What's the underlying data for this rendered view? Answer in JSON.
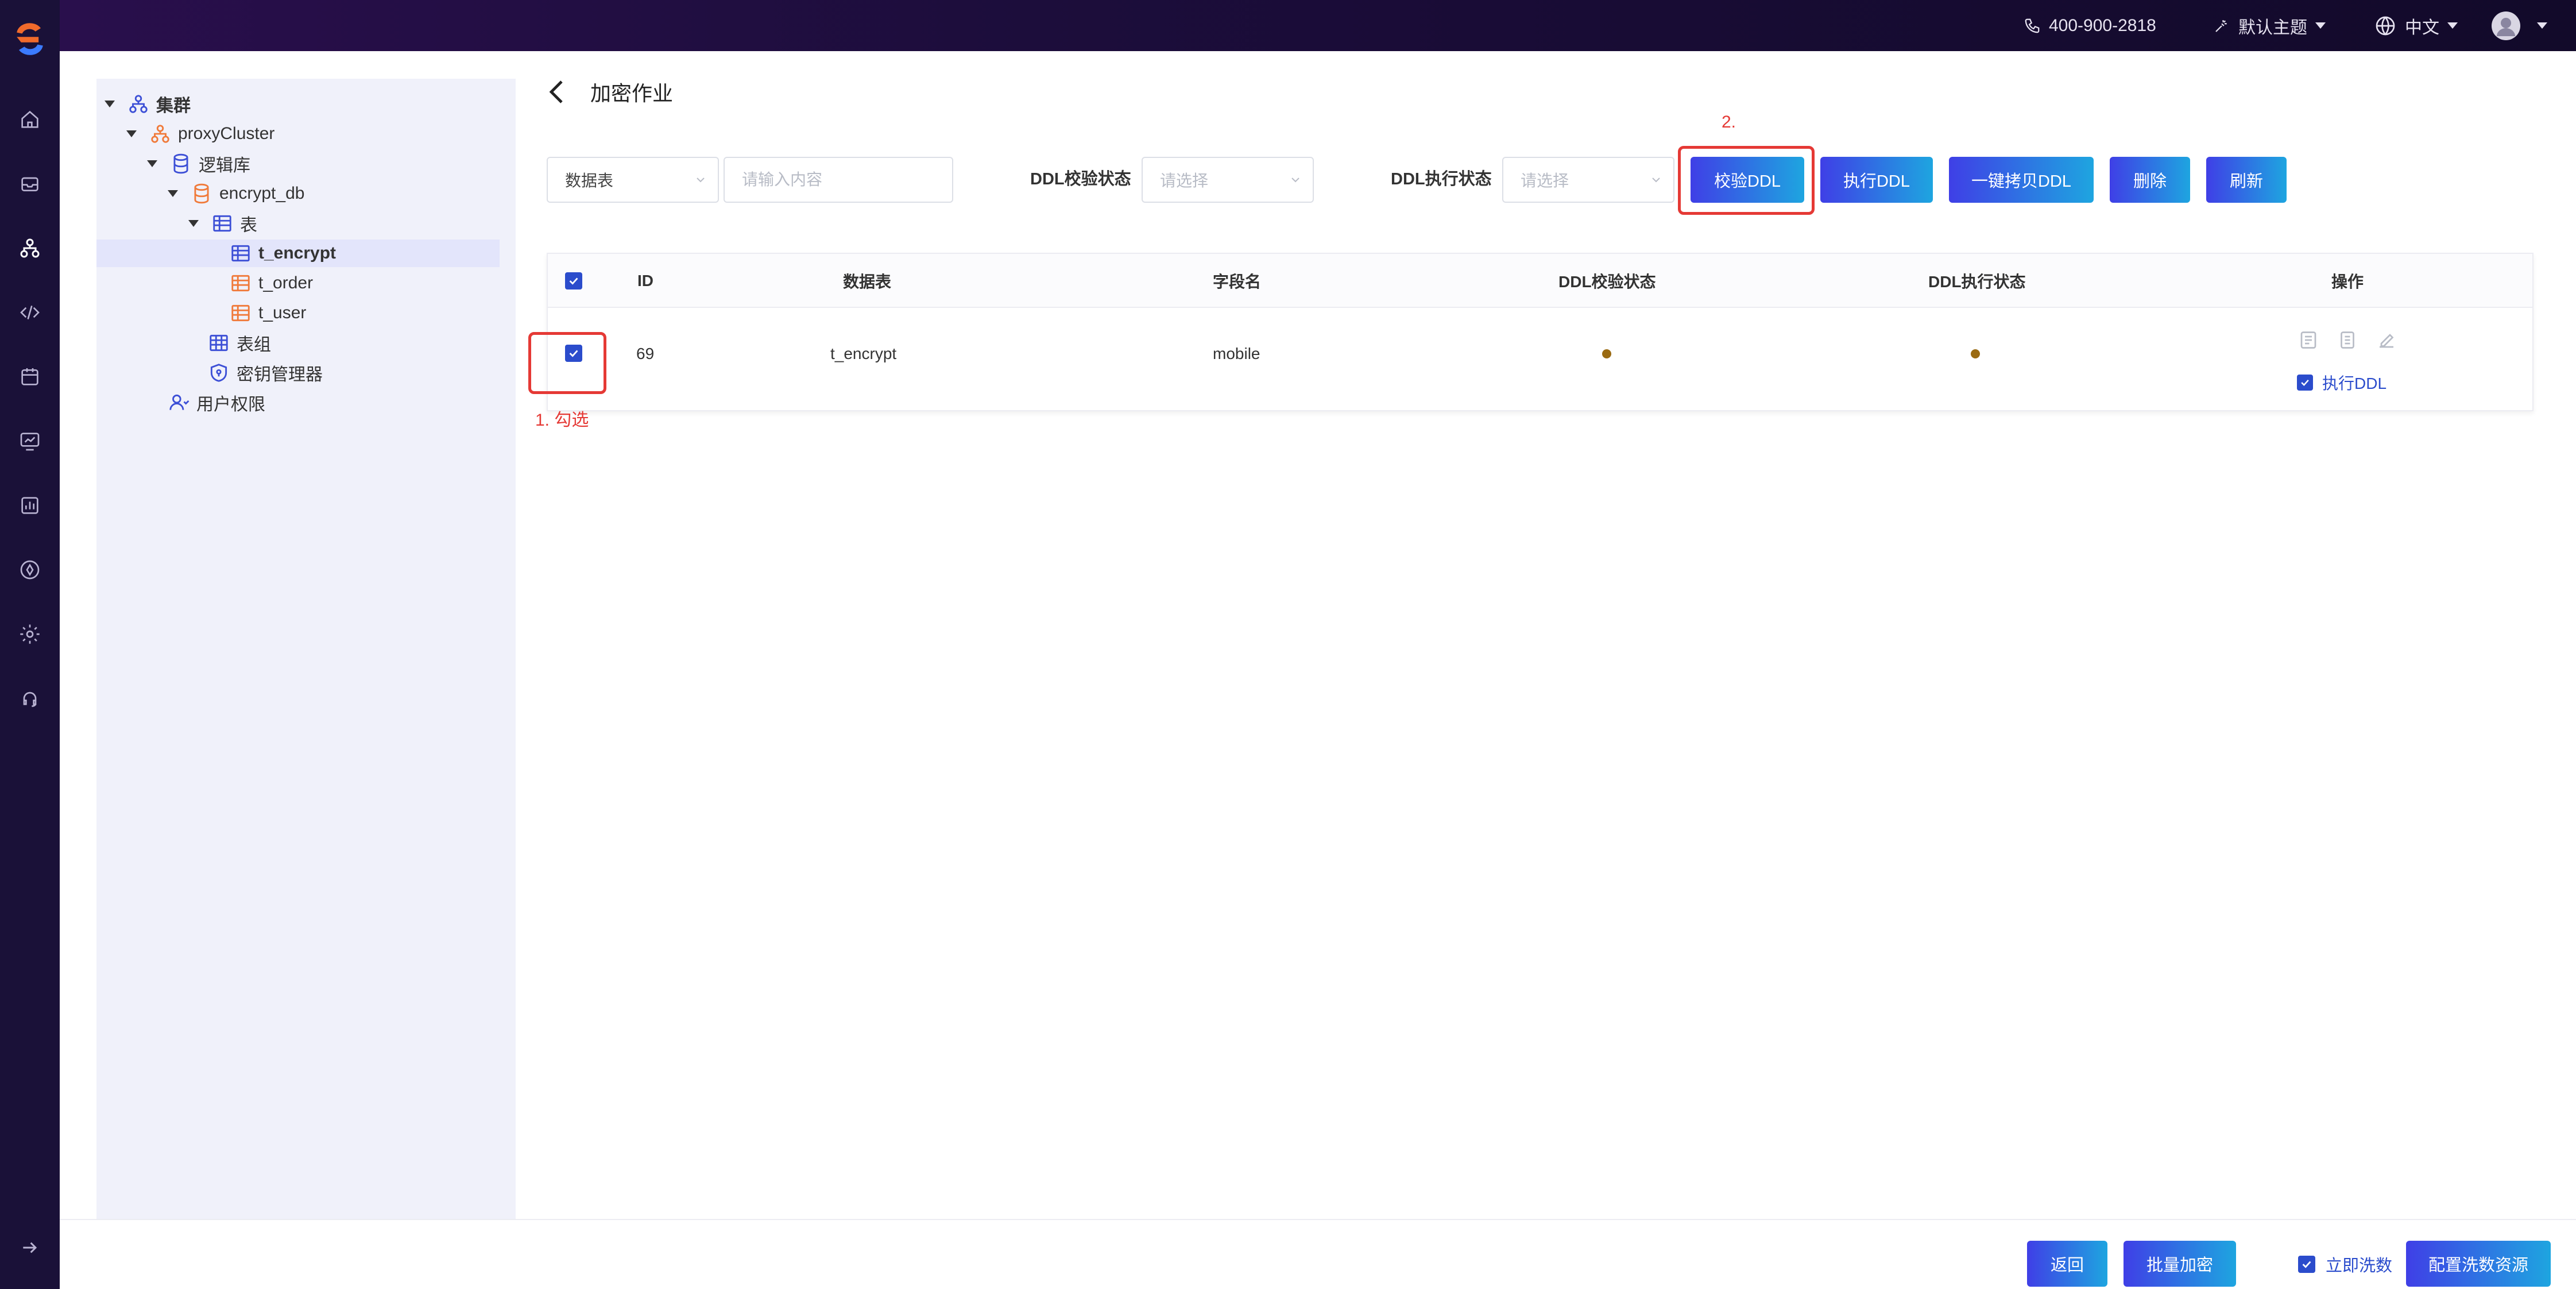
{
  "header": {
    "phone": "400-900-2818",
    "theme_label": "默认主题",
    "language": "中文"
  },
  "tree": {
    "root": "集群",
    "cluster": "proxyCluster",
    "logic_db": "逻辑库",
    "database": "encrypt_db",
    "tables_group": "表",
    "tables": [
      "t_encrypt",
      "t_order",
      "t_user"
    ],
    "table_set": "表组",
    "key_manager": "密钥管理器",
    "user_permissions": "用户权限"
  },
  "page": {
    "title": "加密作业"
  },
  "filters": {
    "type_select": "数据表",
    "search_placeholder": "请输入内容",
    "ddl_check_label": "DDL校验状态",
    "ddl_check_placeholder": "请选择",
    "ddl_exec_label": "DDL执行状态",
    "ddl_exec_placeholder": "请选择"
  },
  "toolbar": {
    "check_ddl": "校验DDL",
    "exec_ddl": "执行DDL",
    "copy_ddl": "一键拷贝DDL",
    "delete": "删除",
    "refresh": "刷新"
  },
  "annotations": {
    "step1": "1. 勾选",
    "step2": "2."
  },
  "table": {
    "columns": [
      "ID",
      "数据表",
      "字段名",
      "DDL校验状态",
      "DDL执行状态",
      "操作"
    ],
    "rows": [
      {
        "id": "69",
        "table": "t_encrypt",
        "field": "mobile",
        "exec_ddl_label": "执行DDL"
      }
    ]
  },
  "footer": {
    "back": "返回",
    "batch_encrypt": "批量加密",
    "wash_now": "立即洗数",
    "config_wash": "配置洗数资源"
  },
  "colors": {
    "accent": "#2b4ccc",
    "highlight": "#e53935",
    "status_dot": "#9a6a12"
  }
}
